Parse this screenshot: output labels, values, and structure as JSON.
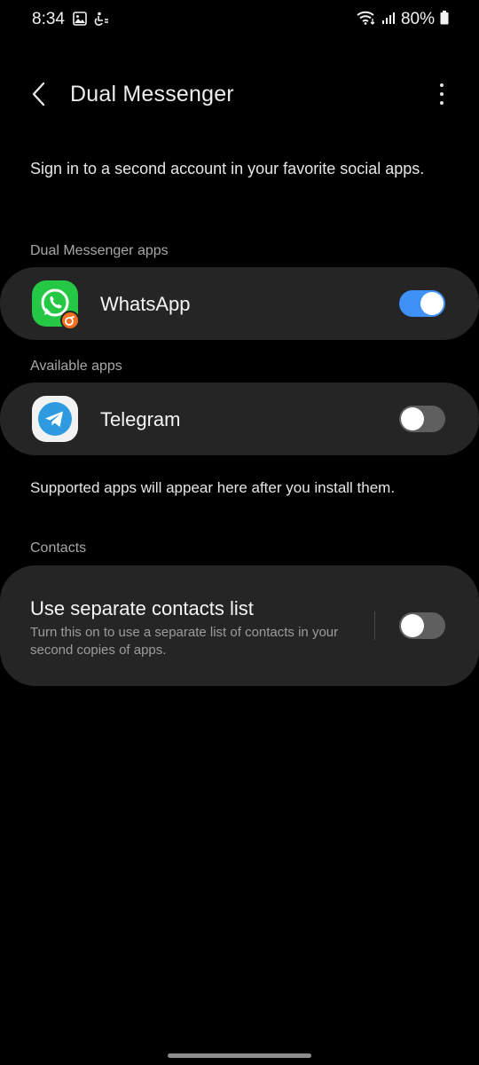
{
  "status_bar": {
    "time": "8:34",
    "battery": "80%"
  },
  "header": {
    "title": "Dual Messenger"
  },
  "description": "Sign in to a second account in your favorite social apps.",
  "sections": {
    "dual_apps_label": "Dual Messenger apps",
    "available_apps_label": "Available apps",
    "contacts_label": "Contacts"
  },
  "dual_apps": [
    {
      "name": "WhatsApp",
      "icon": "whatsapp-icon",
      "enabled": true
    }
  ],
  "available_apps": [
    {
      "name": "Telegram",
      "icon": "telegram-icon",
      "enabled": false
    }
  ],
  "supported_info": "Supported apps will appear here after you install them.",
  "contacts": {
    "title": "Use separate contacts list",
    "subtitle": "Turn this on to use a separate list of contacts in your second copies of apps.",
    "enabled": false
  },
  "colors": {
    "background": "#000000",
    "card": "#252525",
    "toggle_on": "#3e91f7",
    "toggle_off": "#5f5f5f",
    "whatsapp_green": "#25c845",
    "dual_badge": "#f36f21",
    "telegram_blue": "#2e9be0"
  }
}
